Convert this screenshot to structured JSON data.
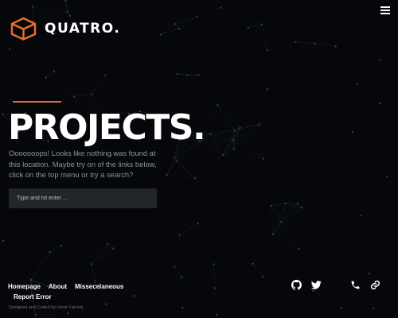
{
  "brand": {
    "name": "QUATRO.",
    "accent_color": "#e8702a",
    "logo_icon": "isometric-cube-icon"
  },
  "header": {
    "menu_icon": "hamburger-icon"
  },
  "main": {
    "title": "PROJECTS.",
    "description": "Ooooooops! Looks like nothing was found at this location. Maybe try on of the links below, click on the top menu or try a search?",
    "search": {
      "placeholder": "Type and hit enter ...",
      "value": ""
    }
  },
  "footer": {
    "nav": [
      "Homepage",
      "About",
      "Missecelaneous",
      "Report Error"
    ],
    "credit": "Designed and Coded by Umar Farooq",
    "social_icons": [
      "github-icon",
      "twitter-icon",
      "phone-icon",
      "link-icon"
    ]
  }
}
